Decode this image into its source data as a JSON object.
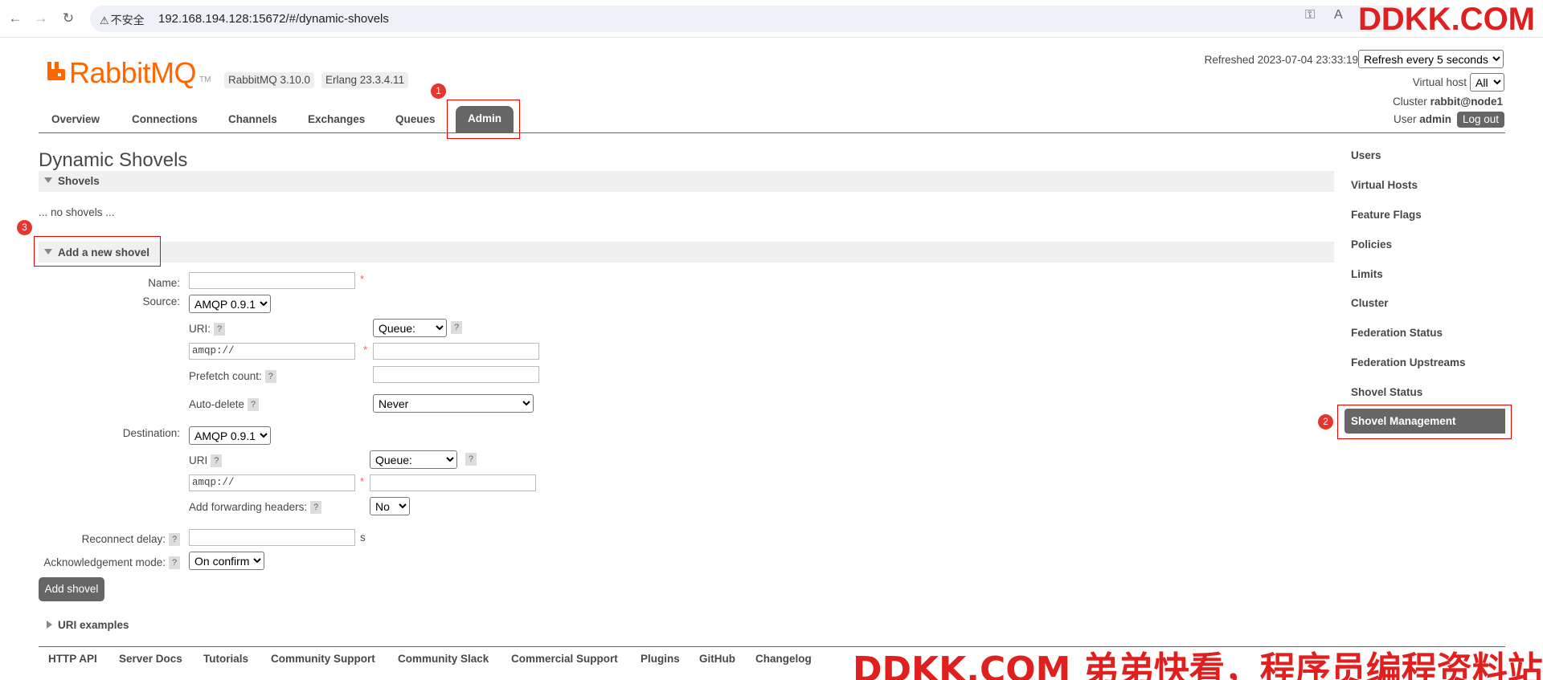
{
  "browser": {
    "security_label": "不安全",
    "url": "192.168.194.128:15672/#/dynamic-shovels"
  },
  "watermark": {
    "top": "DDKK.COM",
    "bottom": "DDKK.COM 弟弟快看，程序员编程资料站"
  },
  "header": {
    "logo_text": "RabbitMQ",
    "logo_tm": "TM",
    "version": "RabbitMQ 3.10.0",
    "erlang": "Erlang 23.3.4.11",
    "refreshed_label": "Refreshed 2023-07-04 23:33:19",
    "refresh_select": "Refresh every 5 seconds",
    "vhost_label": "Virtual host",
    "vhost_select": "All",
    "cluster_label": "Cluster",
    "cluster_value": "rabbit@node1",
    "user_label": "User",
    "user_value": "admin",
    "logout": "Log out"
  },
  "tabs": [
    "Overview",
    "Connections",
    "Channels",
    "Exchanges",
    "Queues",
    "Admin"
  ],
  "badges": [
    "1",
    "2",
    "3"
  ],
  "main": {
    "title": "Dynamic Shovels",
    "shovels_section": "Shovels",
    "no_shovels": "... no shovels ...",
    "add_section": "Add a new shovel",
    "uri_examples": "URI examples"
  },
  "form": {
    "name_label": "Name:",
    "source_label": "Source:",
    "source_protocol": "AMQP 0.9.1",
    "uri_label": "URI:",
    "help": "?",
    "required": "*",
    "source_type": "Queue:",
    "source_uri_value": "amqp://",
    "prefetch_label": "Prefetch count:",
    "auto_delete_label": "Auto-delete",
    "auto_delete_value": "Never",
    "destination_label": "Destination:",
    "destination_protocol": "AMQP 0.9.1",
    "dest_uri_label": "URI",
    "dest_type": "Queue:",
    "dest_uri_value": "amqp://",
    "forward_headers_label": "Add forwarding headers:",
    "forward_headers_value": "No",
    "reconnect_label": "Reconnect delay:",
    "reconnect_unit": "s",
    "ack_label": "Acknowledgement mode:",
    "ack_value": "On confirm",
    "add_button": "Add shovel"
  },
  "sidebar": [
    "Users",
    "Virtual Hosts",
    "Feature Flags",
    "Policies",
    "Limits",
    "Cluster",
    "Federation Status",
    "Federation Upstreams",
    "Shovel Status",
    "Shovel Management"
  ],
  "footer": [
    "HTTP API",
    "Server Docs",
    "Tutorials",
    "Community Support",
    "Community Slack",
    "Commercial Support",
    "Plugins",
    "GitHub",
    "Changelog"
  ],
  "colors": {
    "brand": "#ff6600",
    "active_tab": "#666666",
    "annotation": "#e8352e",
    "watermark": "#e01f1f"
  }
}
